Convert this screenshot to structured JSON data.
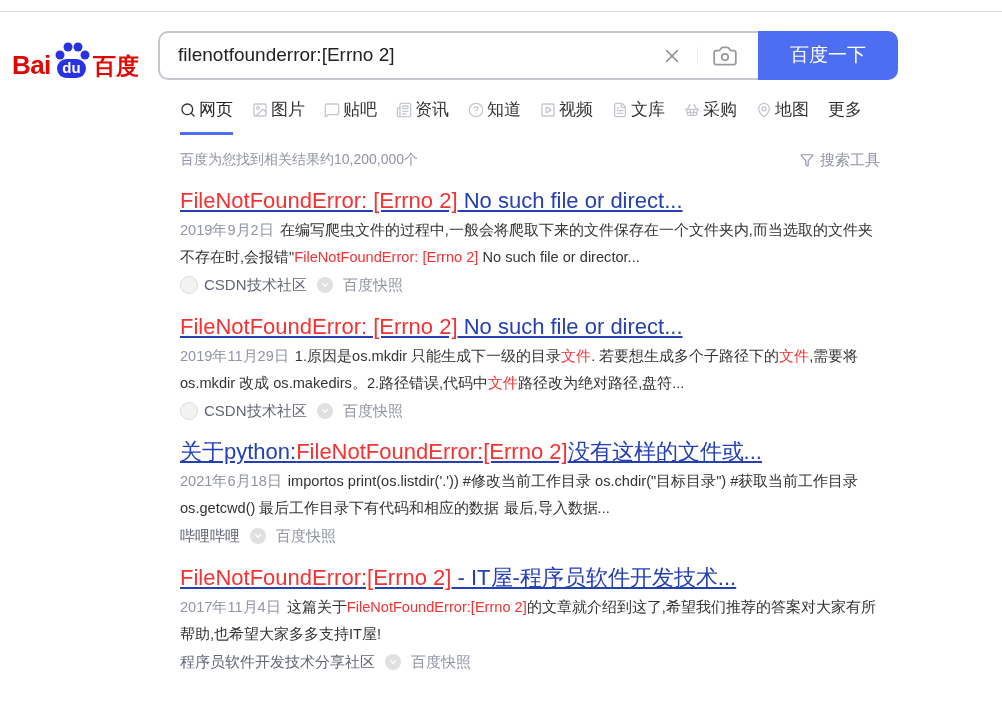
{
  "logo": {
    "left": "Bai",
    "paw": "du",
    "right": "百度"
  },
  "search": {
    "value": "filenotfounderror:[Errno 2]",
    "button": "百度一下"
  },
  "tabs": [
    {
      "label": "网页",
      "selected": true
    },
    {
      "label": "图片",
      "selected": false
    },
    {
      "label": "贴吧",
      "selected": false
    },
    {
      "label": "资讯",
      "selected": false
    },
    {
      "label": "知道",
      "selected": false
    },
    {
      "label": "视频",
      "selected": false
    },
    {
      "label": "文库",
      "selected": false
    },
    {
      "label": "采购",
      "selected": false
    },
    {
      "label": "地图",
      "selected": false
    },
    {
      "label": "更多",
      "selected": false
    }
  ],
  "result_count": "百度为您找到相关结果约10,200,000个",
  "search_tools": "搜索工具",
  "results": [
    {
      "title": [
        {
          "text": "FileNotFoundError: [Errno 2]",
          "highlight": true
        },
        {
          "text": " No such file or direct...",
          "highlight": false
        }
      ],
      "date": "2019年9月2日",
      "snippet": [
        {
          "text": "在编写爬虫文件的过程中,一般会将爬取下来的文件保存在一个文件夹内,而当选取的文件夹不存在时,会报错\"",
          "highlight": false
        },
        {
          "text": "FileNotFoundError: [Errno 2]",
          "highlight": true
        },
        {
          "text": " No such file or director...",
          "highlight": false
        }
      ],
      "source": "CSDN技术社区",
      "logo": true,
      "snapshot": "百度快照"
    },
    {
      "title": [
        {
          "text": "FileNotFoundError: [Errno 2]",
          "highlight": true
        },
        {
          "text": " No such file or direct...",
          "highlight": false
        }
      ],
      "date": "2019年11月29日",
      "snippet": [
        {
          "text": "1.原因是os.mkdir 只能生成下一级的目录",
          "highlight": false
        },
        {
          "text": "文件",
          "highlight": true
        },
        {
          "text": ". 若要想生成多个子路径下的",
          "highlight": false
        },
        {
          "text": "文件",
          "highlight": true
        },
        {
          "text": ",需要将os.mkdir 改成 os.makedirs。2.路径错误,代码中",
          "highlight": false
        },
        {
          "text": "文件",
          "highlight": true
        },
        {
          "text": "路径改为绝对路径,盘符...",
          "highlight": false
        }
      ],
      "source": "CSDN技术社区",
      "logo": true,
      "snapshot": "百度快照"
    },
    {
      "title": [
        {
          "text": "关于python:",
          "highlight": false
        },
        {
          "text": "FileNotFoundError:[Errno 2]",
          "highlight": true
        },
        {
          "text": "没有这样的文件或...",
          "highlight": false
        }
      ],
      "date": "2021年6月18日",
      "snippet": [
        {
          "text": "importos print(os.listdir('.')) #修改当前工作目录 os.chdir(\"目标目录\") #获取当前工作目录 os.getcwd() 最后工作目录下有代码和相应的数据 最后,导入数据...",
          "highlight": false
        }
      ],
      "source": "哔哩哔哩",
      "logo": false,
      "snapshot": "百度快照"
    },
    {
      "title": [
        {
          "text": "FileNotFoundError:[Errno 2]",
          "highlight": true
        },
        {
          "text": " - IT屋-程序员软件开发技术...",
          "highlight": false
        }
      ],
      "date": "2017年11月4日",
      "snippet": [
        {
          "text": "这篇关于",
          "highlight": false
        },
        {
          "text": "FileNotFoundError:[Errno 2]",
          "highlight": true
        },
        {
          "text": "的文章就介绍到这了,希望我们推荐的答案对大家有所帮助,也希望大家多多支持IT屋!",
          "highlight": false
        }
      ],
      "source": "程序员软件开发技术分享社区",
      "logo": false,
      "snapshot": "百度快照"
    }
  ]
}
